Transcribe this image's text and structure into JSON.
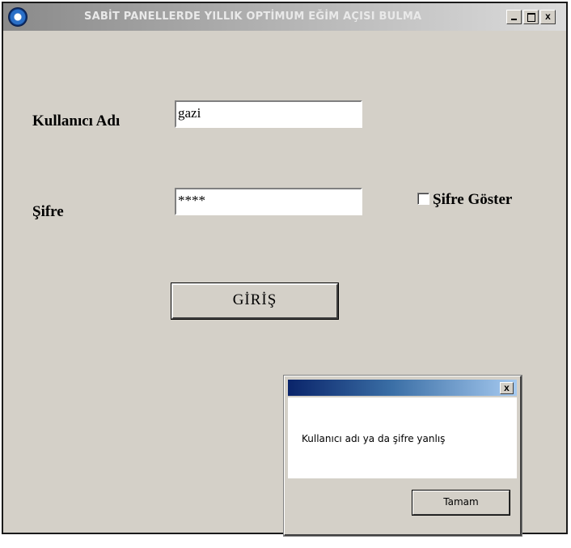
{
  "window": {
    "title": "SABİT PANELLERDE YILLIK OPTİMUM EĞİM AÇISI BULMA",
    "close_glyph": "x"
  },
  "form": {
    "username_label": "Kullanıcı Adı",
    "username_value": "gazi",
    "password_label": "Şifre",
    "password_value": "****",
    "show_password_label": "Şifre Göster",
    "show_password_checked": false,
    "login_button": "GİRİŞ"
  },
  "dialog": {
    "message": "Kullanıcı adı ya da şifre yanlış",
    "ok_button": "Tamam",
    "close_glyph": "x"
  }
}
